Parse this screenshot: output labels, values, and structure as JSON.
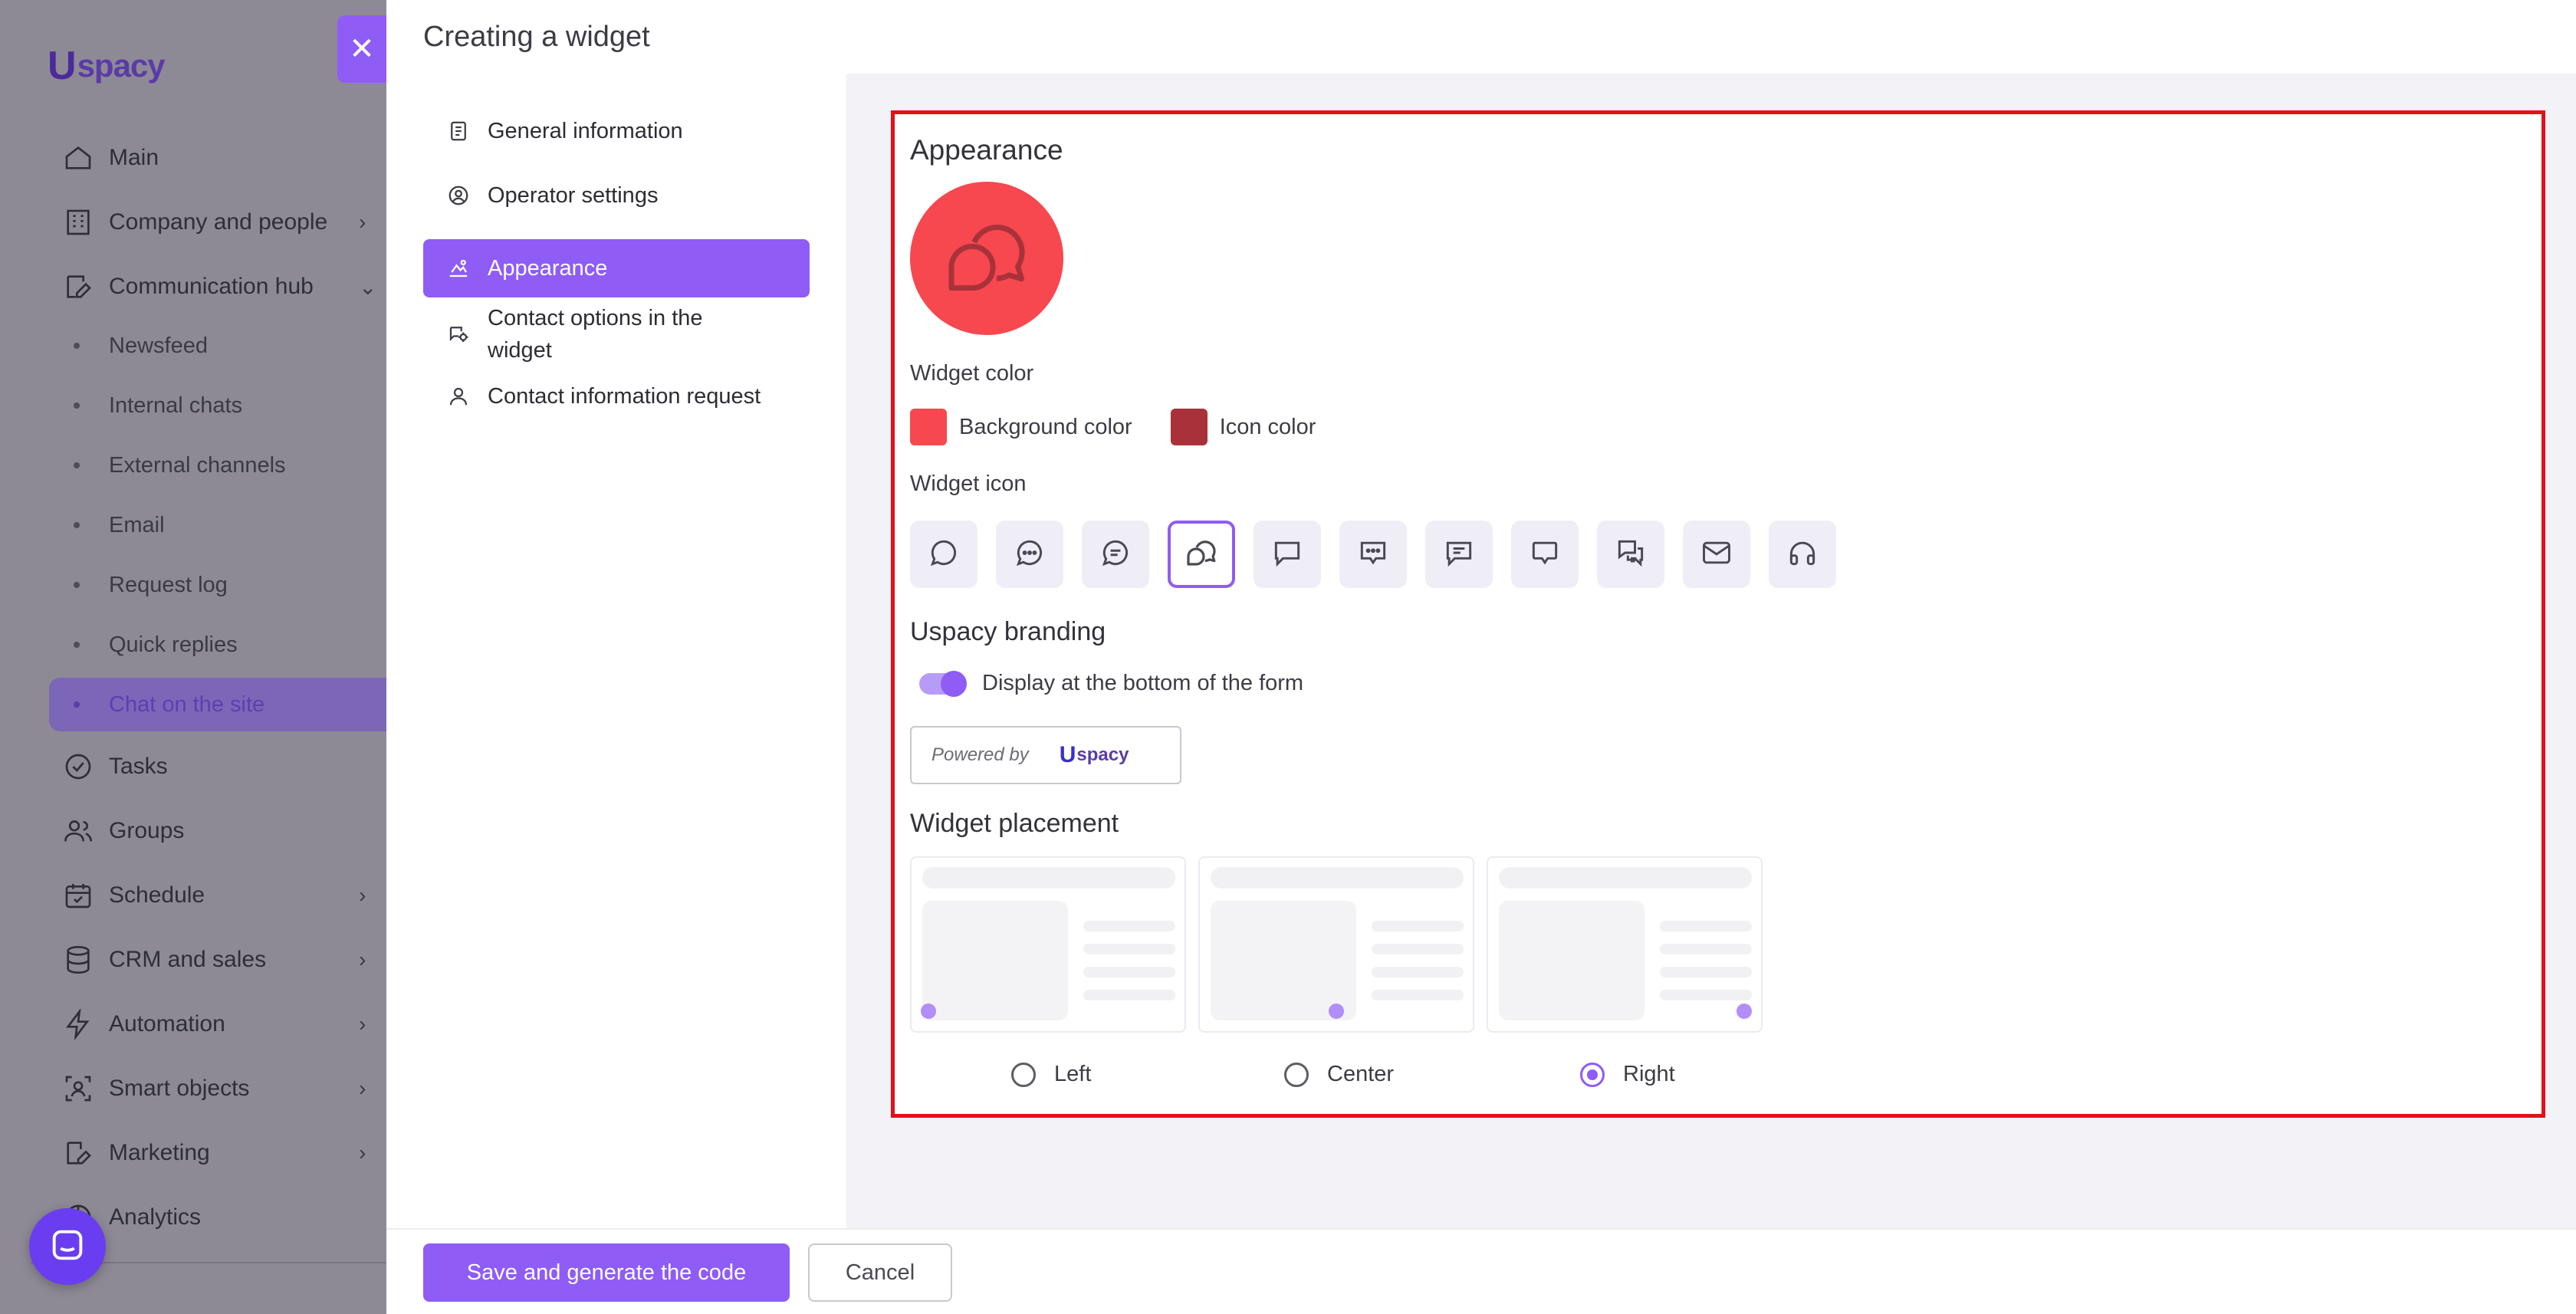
{
  "app": {
    "logo_text": "spacy",
    "logo_letter": "U",
    "nav": [
      {
        "label": "Main",
        "chevron": ""
      },
      {
        "label": "Company and people",
        "chevron": "›"
      },
      {
        "label": "Communication hub",
        "chevron": "⌄"
      },
      {
        "label": "Tasks",
        "chevron": ""
      },
      {
        "label": "Groups",
        "chevron": ""
      },
      {
        "label": "Schedule",
        "chevron": "›"
      },
      {
        "label": "CRM and sales",
        "chevron": "›"
      },
      {
        "label": "Automation",
        "chevron": "›"
      },
      {
        "label": "Smart objects",
        "chevron": "›"
      },
      {
        "label": "Marketing",
        "chevron": "›"
      },
      {
        "label": "Analytics",
        "chevron": ""
      }
    ],
    "subnav": [
      "Newsfeed",
      "Internal chats",
      "External channels",
      "Email",
      "Request log",
      "Quick replies",
      "Chat on the site"
    ],
    "active_subnav": "Chat on the site"
  },
  "panel": {
    "title": "Creating a widget",
    "close_icon": "close-icon",
    "menu": [
      {
        "label": "General information",
        "icon": "document-icon",
        "active": false
      },
      {
        "label": "Operator settings",
        "icon": "user-circle-icon",
        "active": false
      },
      {
        "label": "Appearance",
        "icon": "brush-icon",
        "active": true
      },
      {
        "label": "Contact options in the widget",
        "icon": "chat-settings-icon",
        "active": false
      },
      {
        "label": "Contact information request",
        "icon": "person-icon",
        "active": false
      }
    ]
  },
  "appearance": {
    "title": "Appearance",
    "widget_color_label": "Widget color",
    "background_color_label": "Background color",
    "background_color": "#f7474f",
    "icon_color_label": "Icon color",
    "icon_color": "#a9323a",
    "widget_icon_label": "Widget icon",
    "icons": [
      "chat-round-icon",
      "chat-dots-icon",
      "chat-lines-icon",
      "chat-double-icon",
      "chat-square-icon",
      "chat-square-dots-icon",
      "chat-square-lines-icon",
      "chat-speech-icon",
      "chat-multi-icon",
      "mail-icon",
      "headphones-icon"
    ],
    "selected_icon": "chat-double-icon",
    "branding_title": "Uspacy branding",
    "branding_toggle_label": "Display at the bottom of the form",
    "branding_toggle_on": true,
    "powered_by": "Powered by",
    "placement_title": "Widget placement",
    "placements": [
      {
        "label": "Left",
        "checked": false
      },
      {
        "label": "Center",
        "checked": false
      },
      {
        "label": "Right",
        "checked": true
      }
    ]
  },
  "footer": {
    "save_label": "Save and generate the code",
    "cancel_label": "Cancel"
  },
  "colors": {
    "accent": "#8f5cf6",
    "highlight_border": "#e1111a"
  }
}
